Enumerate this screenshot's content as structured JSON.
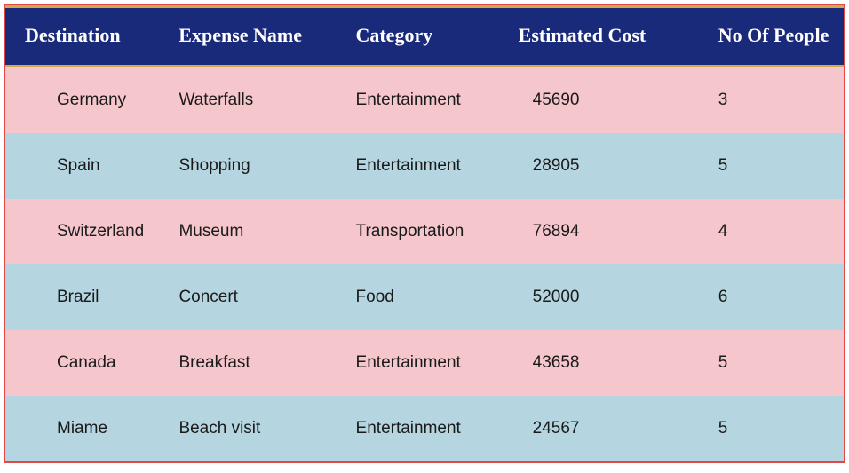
{
  "headers": {
    "col1": "Destination",
    "col2": "Expense Name",
    "col3": "Category",
    "col4": "Estimated Cost",
    "col5": "No Of People"
  },
  "rows": [
    {
      "destination": "Germany",
      "expense": "Waterfalls",
      "category": "Entertainment",
      "cost": "45690",
      "people": "3"
    },
    {
      "destination": "Spain",
      "expense": "Shopping",
      "category": "Entertainment",
      "cost": "28905",
      "people": "5"
    },
    {
      "destination": "Switzerland",
      "expense": "Museum",
      "category": "Transportation",
      "cost": "76894",
      "people": "4"
    },
    {
      "destination": "Brazil",
      "expense": "Concert",
      "category": "Food",
      "cost": "52000",
      "people": "6"
    },
    {
      "destination": "Canada",
      "expense": "Breakfast",
      "category": "Entertainment",
      "cost": "43658",
      "people": "5"
    },
    {
      "destination": "Miame",
      "expense": "Beach visit",
      "category": "Entertainment",
      "cost": "24567",
      "people": "5"
    }
  ]
}
